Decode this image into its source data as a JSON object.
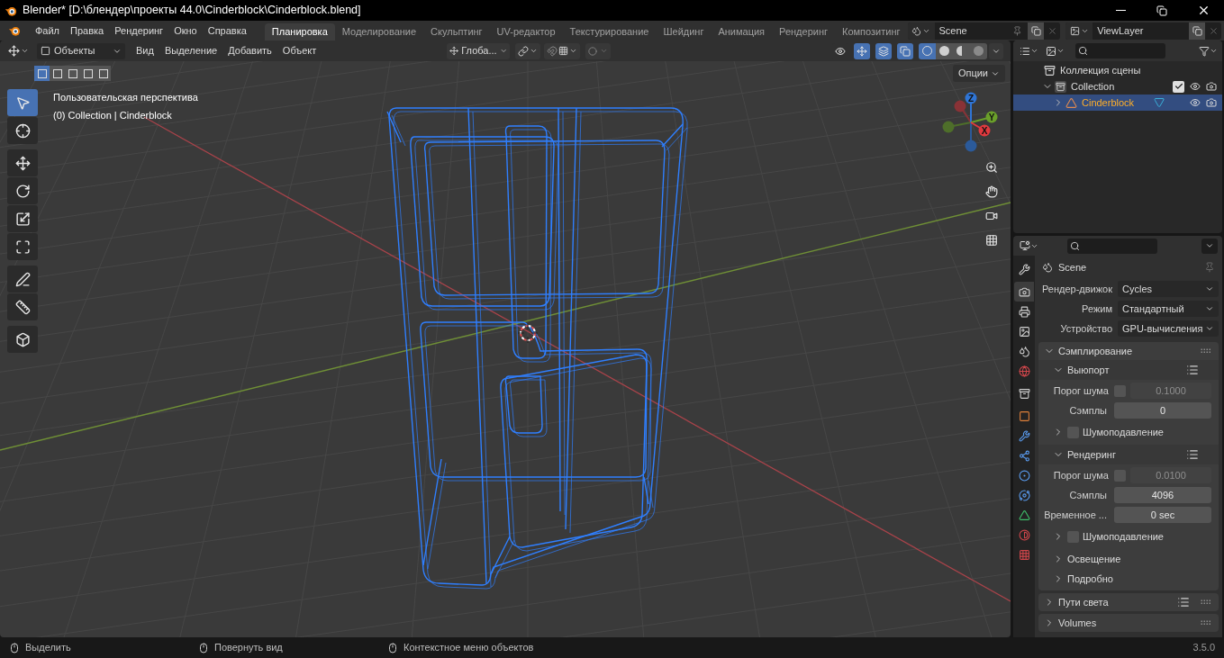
{
  "window": {
    "title": "Blender* [D:\\блендер\\проекты 44.0\\Cinderblock\\Cinderblock.blend]"
  },
  "menu_bar": {
    "items": [
      "Файл",
      "Правка",
      "Рендеринг",
      "Окно",
      "Справка"
    ]
  },
  "workspaces": [
    {
      "label": "Планировка",
      "selected": true
    },
    {
      "label": "Моделирование",
      "selected": false
    },
    {
      "label": "Скульптинг",
      "selected": false
    },
    {
      "label": "UV-редактор",
      "selected": false
    },
    {
      "label": "Текстурирование",
      "selected": false
    },
    {
      "label": "Шейдинг",
      "selected": false
    },
    {
      "label": "Анимация",
      "selected": false
    },
    {
      "label": "Рендеринг",
      "selected": false
    },
    {
      "label": "Композитинг",
      "selected": false
    }
  ],
  "scene": {
    "name": "Scene"
  },
  "view_layer": {
    "name": "ViewLayer"
  },
  "viewport": {
    "mode": "Объекты",
    "menus": [
      "Вид",
      "Выделение",
      "Добавить",
      "Объект"
    ],
    "orientation": "Глоба...",
    "options": "Опции",
    "select_modes": [
      {
        "selected": true
      },
      {
        "selected": false
      },
      {
        "selected": false
      },
      {
        "selected": false
      },
      {
        "selected": false
      }
    ],
    "toggles": [
      {
        "kind": "visibility",
        "on": false
      },
      {
        "kind": "gizmos",
        "on": true
      },
      {
        "kind": "overlays",
        "on": true
      },
      {
        "kind": "xray",
        "on": true
      }
    ],
    "shading": [
      {
        "kind": "wireframe",
        "selected": true
      },
      {
        "kind": "solid",
        "selected": false
      },
      {
        "kind": "material",
        "selected": false
      },
      {
        "kind": "rendered",
        "selected": false
      }
    ],
    "overlay_text": [
      "Пользовательская перспектива",
      "(0) Collection | Cinderblock"
    ],
    "tools": [
      {
        "kind": "select",
        "selected": true
      },
      {
        "kind": "cursor",
        "selected": false
      },
      {
        "kind": "move",
        "selected": false
      },
      {
        "kind": "rotate",
        "selected": false
      },
      {
        "kind": "scale",
        "selected": false
      },
      {
        "kind": "transform",
        "selected": false
      },
      {
        "kind": "annotate",
        "selected": false
      },
      {
        "kind": "measure",
        "selected": false
      },
      {
        "kind": "add_cube",
        "selected": false
      }
    ],
    "gizmo": {
      "axes": [
        {
          "label": "Z",
          "color": "#2f75d6"
        },
        {
          "label": "Y",
          "color": "#6a9f2a"
        },
        {
          "label": "X",
          "color": "#e0393e"
        }
      ]
    }
  },
  "outliner": {
    "items": [
      {
        "label": "Коллекция сцены",
        "kind": "scene_collection",
        "selected": false,
        "children": [
          {
            "label": "Collection",
            "kind": "collection",
            "selected": false,
            "expanded": true,
            "checked": true,
            "children": [
              {
                "label": "Cinderblock",
                "kind": "object",
                "selected": true,
                "expanded": false
              }
            ]
          }
        ]
      }
    ]
  },
  "properties": {
    "tabs": [
      {
        "kind": "tool",
        "selected": false
      },
      {
        "kind": "render",
        "selected": true
      },
      {
        "kind": "output",
        "selected": false
      },
      {
        "kind": "view_layer",
        "selected": false
      },
      {
        "kind": "scene",
        "selected": false
      },
      {
        "kind": "world",
        "selected": false
      },
      {
        "kind": "collection",
        "selected": false
      },
      {
        "kind": "object",
        "selected": false
      },
      {
        "kind": "modifiers",
        "selected": false
      },
      {
        "kind": "particles",
        "selected": false
      },
      {
        "kind": "physics",
        "selected": false
      },
      {
        "kind": "constraints",
        "selected": false
      },
      {
        "kind": "data",
        "selected": false
      },
      {
        "kind": "material",
        "selected": false
      },
      {
        "kind": "texture",
        "selected": false
      }
    ],
    "context": "Scene",
    "fields": [
      {
        "label": "Рендер-движок",
        "value": "Cycles"
      },
      {
        "label": "Режим",
        "value": "Стандартный"
      },
      {
        "label": "Устройство",
        "value": "GPU-вычисления"
      }
    ],
    "panels": [
      {
        "label": "Сэмплирование",
        "expanded": true,
        "presets": false,
        "children": [
          {
            "kind": "subpanel",
            "label": "Выюпорт",
            "expanded": true,
            "presets": true,
            "children": [
              {
                "kind": "check_number",
                "label": "Порог шума",
                "checked": false,
                "value": "0.1000"
              },
              {
                "kind": "number",
                "label": "Сэмплы",
                "value": "0"
              },
              {
                "kind": "check_subpanel",
                "label": "Шумоподавление",
                "expanded": false,
                "checked": false
              }
            ]
          },
          {
            "kind": "subpanel",
            "label": "Рендеринг",
            "expanded": true,
            "presets": true,
            "children": [
              {
                "kind": "check_number",
                "label": "Порог шума",
                "checked": false,
                "value": "0.0100"
              },
              {
                "kind": "number",
                "label": "Сэмплы",
                "value": "4096"
              },
              {
                "kind": "number",
                "label": "Временное ...",
                "value": "0 sec"
              },
              {
                "kind": "check_subpanel",
                "label": "Шумоподавление",
                "expanded": false,
                "checked": false
              }
            ]
          },
          {
            "kind": "subpanel",
            "label": "Освещение",
            "expanded": false,
            "presets": false
          },
          {
            "kind": "subpanel",
            "label": "Подробно",
            "expanded": false,
            "presets": false
          }
        ]
      },
      {
        "label": "Пути света",
        "expanded": false,
        "presets": true
      },
      {
        "label": "Volumes",
        "expanded": false,
        "presets": false
      }
    ]
  },
  "status_bar": {
    "items": [
      "Выделить",
      "Повернуть вид",
      "Контекстное меню объектов"
    ],
    "version": "3.5.0"
  }
}
